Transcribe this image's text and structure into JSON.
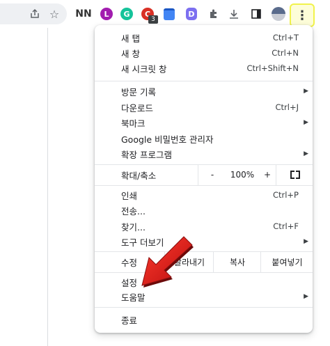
{
  "menu": {
    "new_tab": {
      "label": "새 탭",
      "accel": "Ctrl+T"
    },
    "new_window": {
      "label": "새 창",
      "accel": "Ctrl+N"
    },
    "incognito": {
      "label": "새 시크릿 창",
      "accel": "Ctrl+Shift+N"
    },
    "history": {
      "label": "방문 기록"
    },
    "downloads": {
      "label": "다운로드",
      "accel": "Ctrl+J"
    },
    "bookmarks": {
      "label": "북마크"
    },
    "passwords": {
      "label": "Google 비밀번호 관리자"
    },
    "extensions": {
      "label": "확장 프로그램"
    },
    "zoom": {
      "label": "확대/축소",
      "minus": "-",
      "value": "100%",
      "plus": "+"
    },
    "print": {
      "label": "인쇄",
      "accel": "Ctrl+P"
    },
    "cast": {
      "label": "전송..."
    },
    "find": {
      "label": "찾기...",
      "accel": "Ctrl+F"
    },
    "more_tools": {
      "label": "도구 더보기"
    },
    "edit": {
      "label": "수정",
      "cut": "잘라내기",
      "copy": "복사",
      "paste": "붙여넣기"
    },
    "settings": {
      "label": "설정"
    },
    "help": {
      "label": "도움말"
    },
    "exit": {
      "label": "종료"
    }
  },
  "toolbar": {
    "badge_count": "3",
    "ext_icons": [
      "share-icon",
      "star-icon",
      "NN",
      "L",
      "G",
      "C",
      "calendar-icon",
      "D",
      "puzzle-icon",
      "download-icon",
      "sidepanel-icon",
      "profile-icon"
    ]
  },
  "colors": {
    "highlight_border": "#f1f24b",
    "arrow_red": "#e0191a"
  }
}
